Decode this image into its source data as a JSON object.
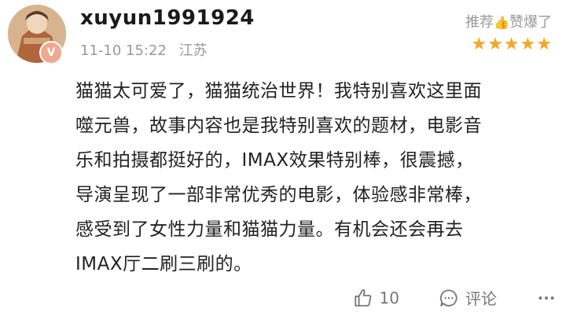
{
  "user": {
    "name": "xuyun1991924",
    "time": "11-10 15:22",
    "location": "江苏",
    "badge": "V"
  },
  "rating": {
    "tag_prefix": "推荐",
    "tag_suffix": "赞爆了",
    "stars": 5
  },
  "comment": {
    "lines": [
      "猫猫太可爱了，猫猫统治世界！我特别喜欢这里面",
      "噬元兽，故事内容也是我特别喜欢的题材，电影音",
      "乐和拍摄都挺好的，IMAX效果特别棒，很震撼，",
      "导演呈现了一部非常优秀的电影，体验感非常棒，",
      "感受到了女性力量和猫猫力量。有机会还会再去",
      "IMAX厅二刷三刷的。"
    ]
  },
  "actions": {
    "like_count": "10",
    "comment_label": "评论"
  }
}
